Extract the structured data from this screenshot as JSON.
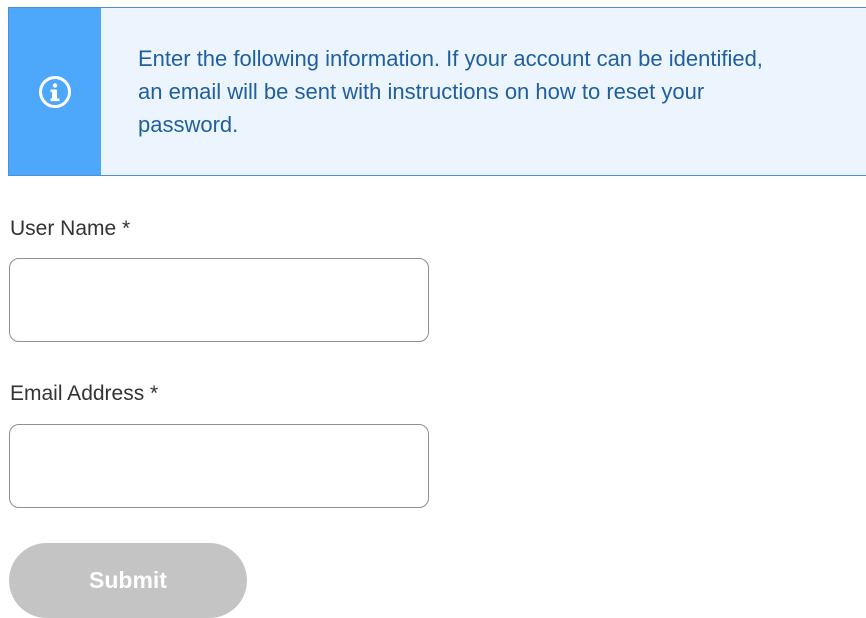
{
  "info_banner": {
    "icon": "info-circle-icon",
    "message": "Enter the following information. If your account can be identified, an email will be sent with instructions on how to reset your password.",
    "colors": {
      "stripe": "#4da8fb",
      "background": "#ecf5fe",
      "text": "#1f5e9f",
      "border": "#4b8fd6"
    }
  },
  "form": {
    "username": {
      "label": "User Name *",
      "value": "",
      "placeholder": ""
    },
    "email": {
      "label": "Email Address *",
      "value": "",
      "placeholder": ""
    },
    "submit": {
      "label": "Submit",
      "disabled": true,
      "color": "#c4c4c4"
    }
  }
}
